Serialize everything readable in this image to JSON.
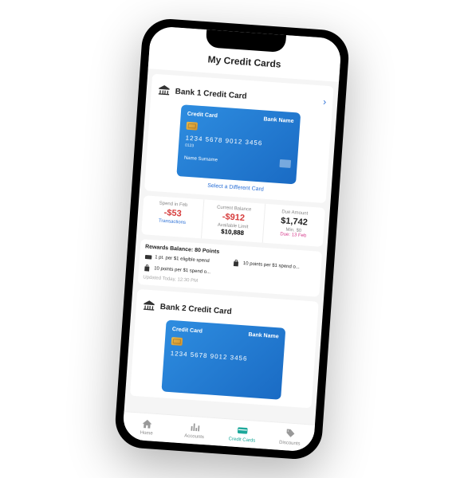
{
  "header": {
    "title": "My Credit Cards"
  },
  "card1": {
    "title": "Bank 1 Credit Card",
    "cc_label": "Credit Card",
    "cc_bank": "Bank Name",
    "cc_number": "1234  5678  9012  3456",
    "cc_exp": "0123",
    "cc_name": "Name Surname",
    "select_link": "Select a Different Card"
  },
  "stats": {
    "spend_label": "Spend in Feb",
    "spend_value": "-$53",
    "spend_link": "Transactions",
    "balance_label": "Current Balance",
    "balance_value": "-$912",
    "av_label": "Available Limit",
    "av_value": "$10,888",
    "due_label": "Due Amount",
    "due_value": "$1,742",
    "due_min": "Min. $0",
    "due_date": "Due: 13 Feb"
  },
  "rewards": {
    "title": "Rewards Balance: 80 Points",
    "item1": "1 pt. per $1 eligible spend",
    "item2": "10 points per $1 spend o...",
    "item3": "10 points per $1 spend o...",
    "updated": "Updated Today, 12:30 PM"
  },
  "card2": {
    "title": "Bank 2 Credit Card",
    "cc_label": "Credit Card",
    "cc_bank": "Bank Name",
    "cc_number": "1234  5678  9012  3456"
  },
  "tabs": {
    "home": "Home",
    "accounts": "Accounts",
    "cards": "Credit Cards",
    "discounts": "Discounts"
  }
}
